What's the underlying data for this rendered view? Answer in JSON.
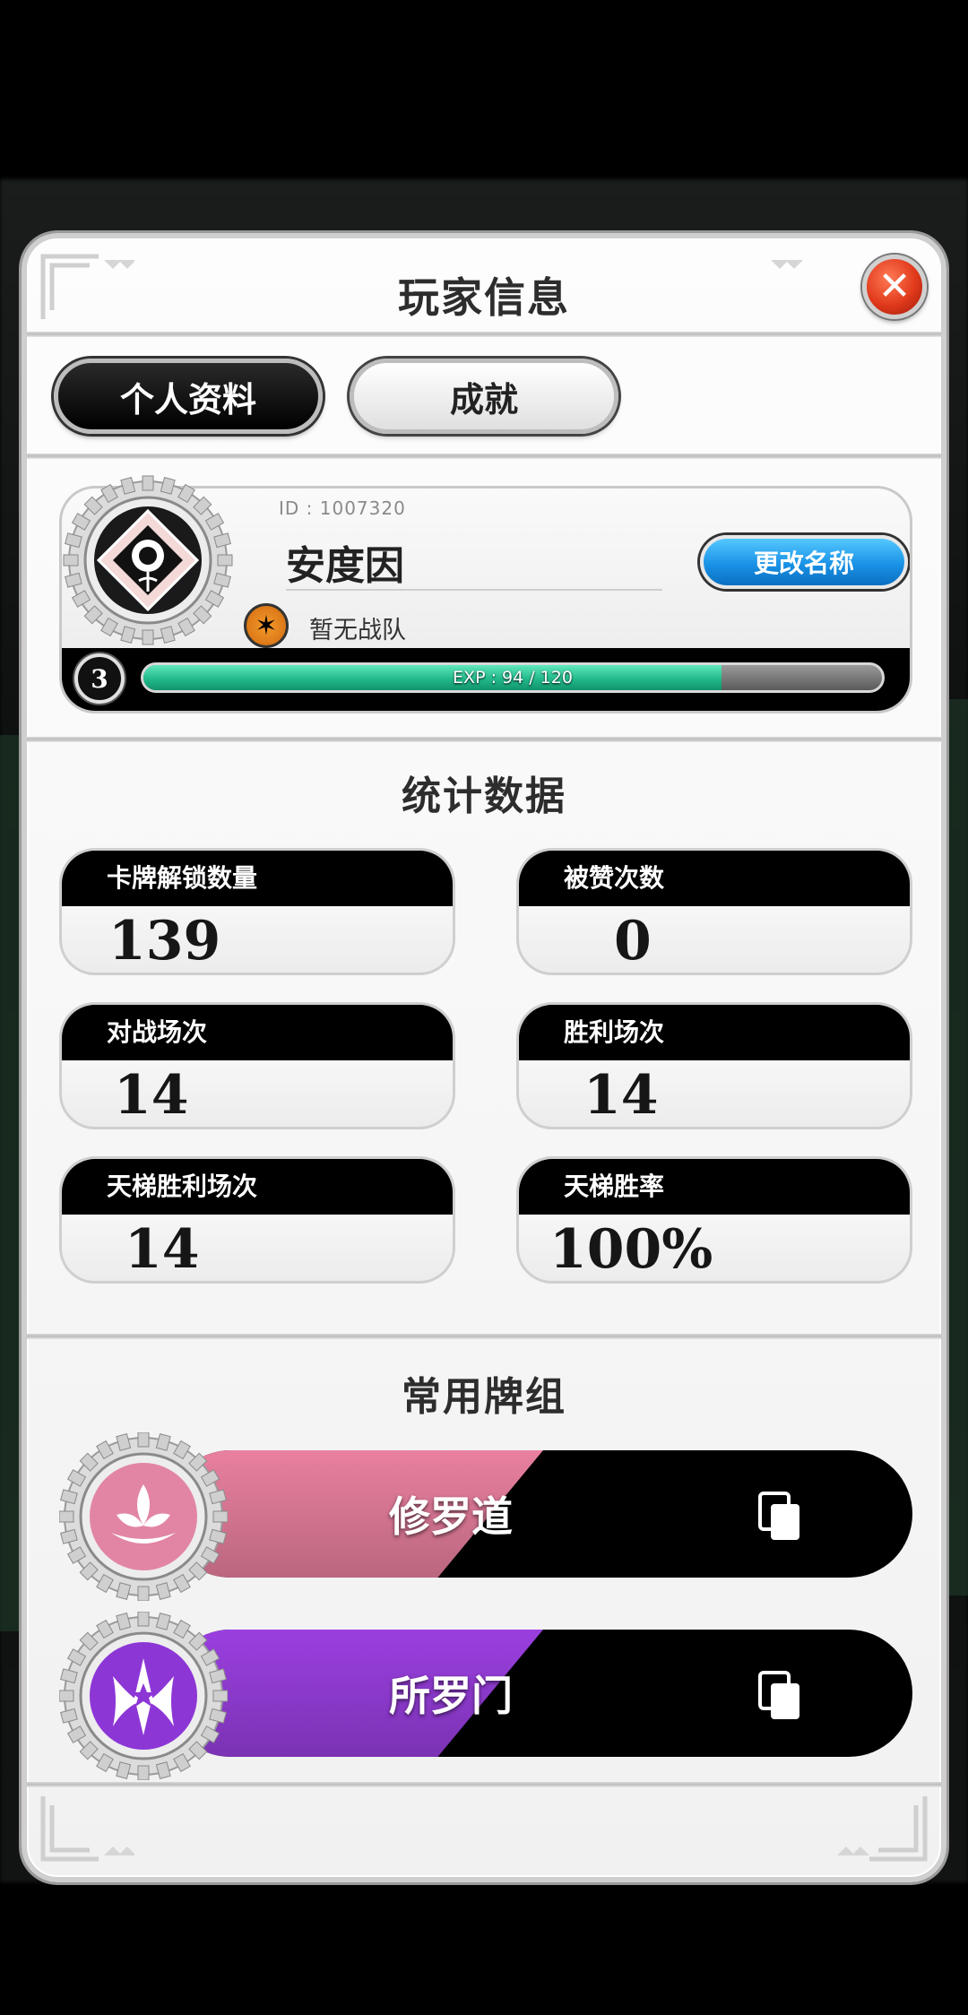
{
  "dialog": {
    "title": "玩家信息",
    "close_symbol": "✕",
    "close_icon": "close-icon"
  },
  "tabs": [
    {
      "label": "个人资料",
      "active": true
    },
    {
      "label": "成就",
      "active": false
    }
  ],
  "profile": {
    "id_text": "ID : 1007320",
    "name": "安度因",
    "rename_label": "更改名称",
    "team_label": "暂无战队",
    "team_icon": "star-badge-icon",
    "level": "3",
    "exp_text": "EXP : 94 / 120",
    "exp_fraction": 0.783,
    "avatar_icon": "rose-emblem-icon"
  },
  "stats_section": {
    "title": "统计数据",
    "items": [
      {
        "label": "卡牌解锁数量",
        "value": "139"
      },
      {
        "label": "被赞次数",
        "value": "0"
      },
      {
        "label": "对战场次",
        "value": "14"
      },
      {
        "label": "胜利场次",
        "value": "14"
      },
      {
        "label": "天梯胜利场次",
        "value": "14"
      },
      {
        "label": "天梯胜率",
        "value": "100%"
      }
    ]
  },
  "decks_section": {
    "title": "常用牌组",
    "decks": [
      {
        "name": "修罗道",
        "color": "#e9809f",
        "icon": "lotus-icon",
        "copy_icon": "copy-icon"
      },
      {
        "name": "所罗门",
        "color": "#9a3fe0",
        "icon": "solomon-sigil-icon",
        "copy_icon": "copy-icon"
      }
    ]
  },
  "colors": {
    "rename_button": "#1992e6",
    "exp_fill": "#22b98b",
    "close_button": "#e0391b"
  }
}
